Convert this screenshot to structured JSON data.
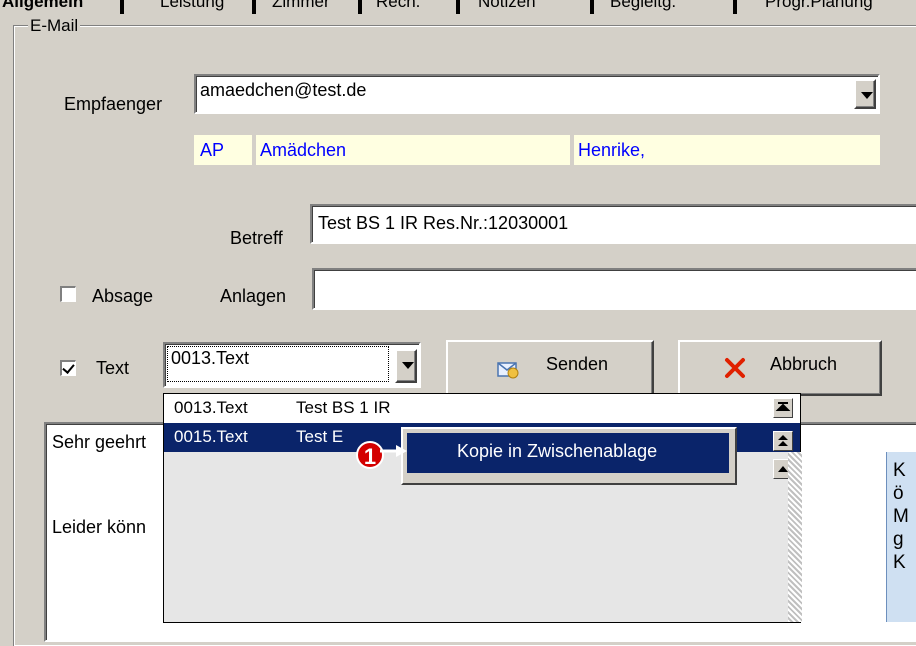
{
  "tabs": [
    "Allgemein",
    "Leistung",
    "Zimmer",
    "Rech.",
    "Notizen",
    "Begleitg.",
    "Progr.Planung"
  ],
  "group_title": "E-Mail",
  "recipient": {
    "label": "Empfaenger",
    "value": "amaedchen@test.de",
    "info": {
      "ap": "AP",
      "lastname": "Amädchen",
      "firstname": "Henrike,"
    }
  },
  "subject": {
    "label": "Betreff",
    "value": "Test BS 1 IR Res.Nr.:12030001"
  },
  "absage": {
    "label": "Absage",
    "checked": false
  },
  "attachments": {
    "label": "Anlagen",
    "value": ""
  },
  "text_option": {
    "label": "Text",
    "checked": true,
    "selected": "0013.Text"
  },
  "buttons": {
    "send": "Senden",
    "cancel": "Abbruch"
  },
  "dropdown": {
    "items": [
      {
        "code": "0013.Text",
        "name": "Test BS 1 IR"
      },
      {
        "code": "0015.Text",
        "name": "Test E"
      }
    ]
  },
  "context_menu": {
    "item": "Kopie in Zwischenablage"
  },
  "step_badge": "1",
  "body_lines": [
    "Sehr geehrt",
    "Leider könn"
  ],
  "tooltip_lines": [
    "K",
    "ö",
    "M",
    "g",
    "K"
  ],
  "colors": {
    "selection": "#0a246a",
    "blue_text": "#0000ff",
    "info_bg": "#ffffe1",
    "tooltip_bg": "#cfe0f2"
  }
}
